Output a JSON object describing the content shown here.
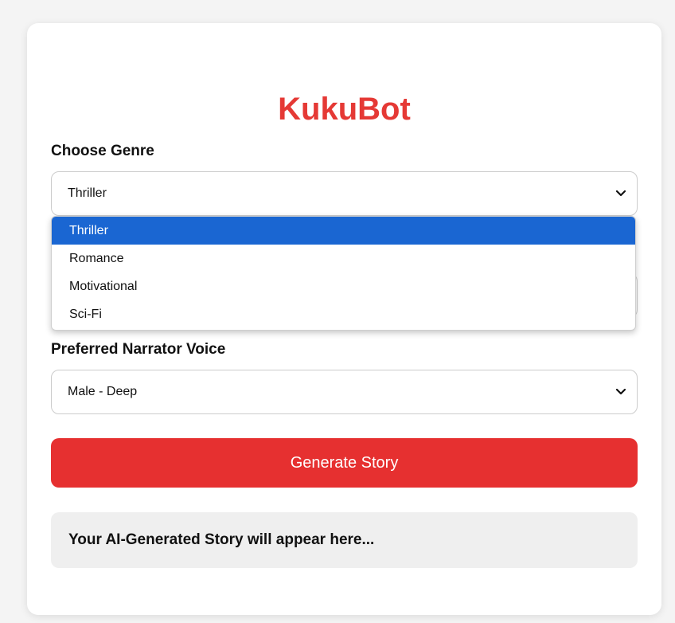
{
  "app": {
    "title": "KukuBot"
  },
  "genre": {
    "label": "Choose Genre",
    "selected": "Thriller",
    "options": [
      "Thriller",
      "Romance",
      "Motivational",
      "Sci-Fi"
    ]
  },
  "voice": {
    "label": "Preferred Narrator Voice",
    "selected": "Male - Deep"
  },
  "actions": {
    "generate_label": "Generate Story"
  },
  "output": {
    "placeholder": "Your AI-Generated Story will appear here..."
  },
  "colors": {
    "brand": "#e53935",
    "button": "#e63030",
    "selected_option": "#1a66d2"
  },
  "icons": {
    "select_arrow": "chevron-down-icon"
  }
}
